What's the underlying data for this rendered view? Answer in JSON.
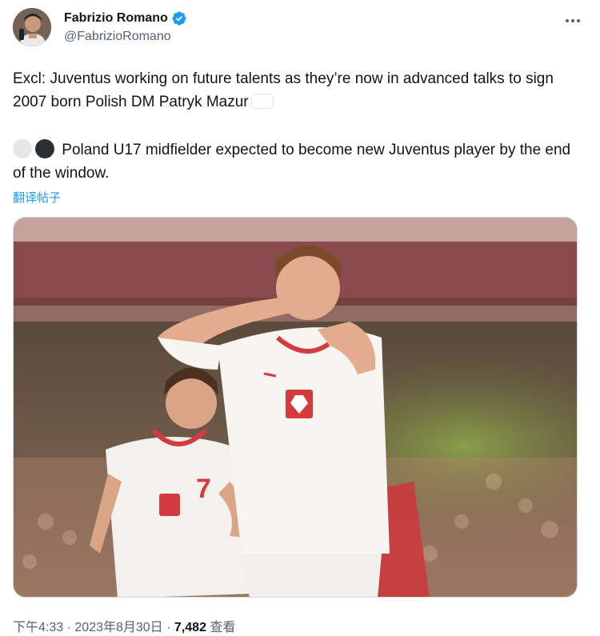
{
  "author": {
    "display_name": "Fabrizio Romano",
    "handle": "@FabrizioRomano"
  },
  "tweet": {
    "line1": "Excl: Juventus working on future talents as they’re now in advanced talks to sign 2007 born Polish DM Patryk Mazur",
    "line2": "Poland U17 midfielder expected to become new Juventus player by the end of the window.",
    "translate_label": "翻译帖子"
  },
  "media": {
    "banner_text": "",
    "shirt_number_front": "7"
  },
  "meta": {
    "time": "下午4:33",
    "date": "2023年8月30日",
    "separator": "·",
    "views_count": "7,482",
    "views_label": "查看"
  },
  "colors": {
    "verified": "#1d9bf0",
    "link": "#1d9bf0",
    "secondary_text": "#536471",
    "poland_red": "#dc2b45"
  },
  "icons": {
    "verified": "verified-badge-icon",
    "more": "more-dots-icon",
    "flag": "poland-flag-icon"
  }
}
